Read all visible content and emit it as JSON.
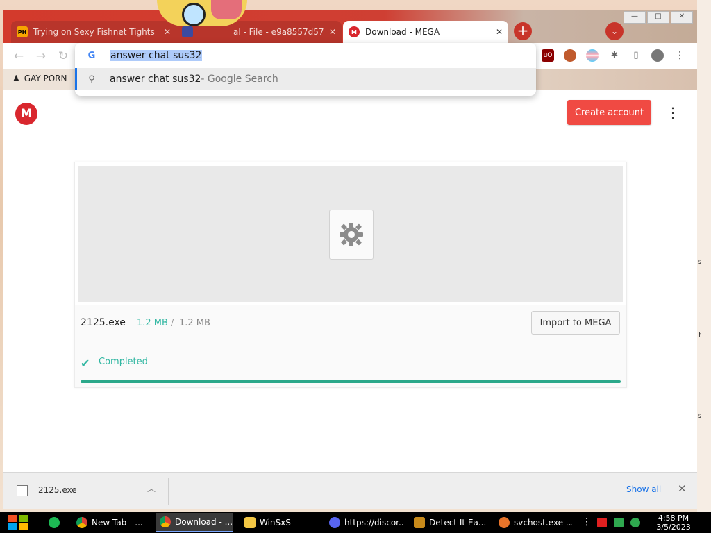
{
  "browser": {
    "tabs": [
      {
        "favicon": "PH",
        "title": "Trying on Sexy Fishnet Tights",
        "active": false
      },
      {
        "favicon": "",
        "title": "al - File - e9a8557d57",
        "active": false
      },
      {
        "favicon": "M",
        "title": "Download - MEGA",
        "active": true
      }
    ],
    "window_buttons": {
      "minimize": "—",
      "maximize": "□",
      "close": "✕"
    },
    "omnibox": {
      "typed_text": "answer chat sus32",
      "suggestion_text": "answer chat sus32",
      "suggestion_suffix": " - Google Search"
    },
    "bookmarks": [
      {
        "label": "GAY PORN"
      }
    ]
  },
  "page": {
    "logo": "M",
    "create_account_label": "Create account",
    "more_icon": "⋮",
    "file": {
      "name": "2125.exe",
      "downloaded": "1.2 MB",
      "separator": "/",
      "total": "1.2 MB"
    },
    "import_label": "Import to MEGA",
    "status": "Completed",
    "progress": 1.0
  },
  "download_shelf": {
    "file": "2125.exe",
    "show_all_label": "Show all"
  },
  "taskbar": {
    "items": [
      {
        "label": "New Tab - ...",
        "icon": "chrome-icon",
        "active": false
      },
      {
        "label": "Download - ...",
        "icon": "chrome-icon",
        "active": true
      },
      {
        "label": "WinSxS",
        "icon": "folder-icon",
        "active": false
      },
      {
        "label": "https://discor...",
        "icon": "discord-icon",
        "active": false
      },
      {
        "label": "Detect It Ea...",
        "icon": "die-icon",
        "active": false
      },
      {
        "label": "svchost.exe ...",
        "icon": "search-tool-icon",
        "active": false
      }
    ],
    "clock": {
      "time": "4:58 PM",
      "date": "3/5/2023"
    }
  }
}
